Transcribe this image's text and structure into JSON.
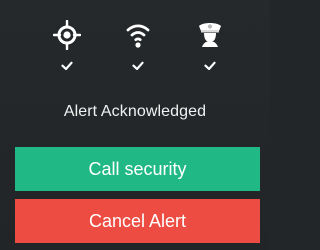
{
  "status": {
    "items": [
      {
        "icon": "location-target-icon",
        "checked": true
      },
      {
        "icon": "wifi-icon",
        "checked": true
      },
      {
        "icon": "security-guard-icon",
        "checked": true
      }
    ]
  },
  "alert": {
    "message": "Alert Acknowledged"
  },
  "actions": {
    "call_security": "Call security",
    "cancel_alert": "Cancel Alert"
  },
  "colors": {
    "background": "#222628",
    "text": "#F1F1F1",
    "success": "#20B985",
    "danger": "#ED4C43"
  }
}
